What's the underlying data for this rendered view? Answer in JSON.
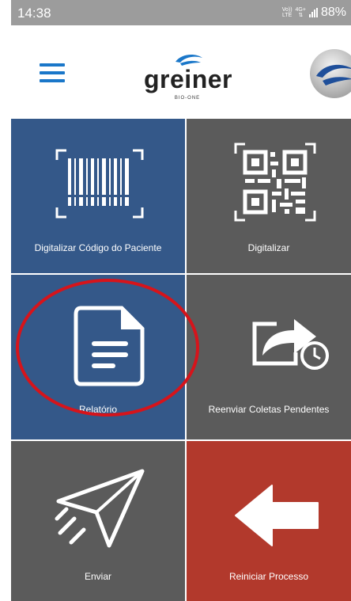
{
  "status_bar": {
    "time": "14:38",
    "volte_label": "Vo))",
    "lte_label": "LTE",
    "network_label": "4G+",
    "battery": "88%"
  },
  "header": {
    "logo_text": "greiner",
    "logo_subtext": "BIO-ONE"
  },
  "tiles": [
    {
      "label": "Digitalizar Código do Paciente",
      "icon": "barcode-icon",
      "color": "#345889"
    },
    {
      "label": "Digitalizar",
      "icon": "qr-code-icon",
      "color": "#5b5b5b"
    },
    {
      "label": "Relatório",
      "icon": "document-icon",
      "color": "#345889"
    },
    {
      "label": "Reenviar Coletas Pendentes",
      "icon": "resend-icon",
      "color": "#5b5b5b"
    },
    {
      "label": "Enviar",
      "icon": "paper-plane-icon",
      "color": "#5b5b5b"
    },
    {
      "label": "Reiniciar Processo",
      "icon": "arrow-left-icon",
      "color": "#b2392c"
    }
  ],
  "annotation": {
    "circle_color": "#d6141b"
  }
}
